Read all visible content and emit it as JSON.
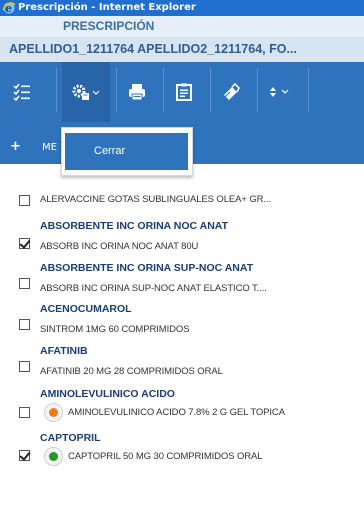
{
  "window": {
    "title": "Prescripción - Internet Explorer"
  },
  "header": {
    "section_title": "PRESCRIPCIÓN",
    "patient_name": "APELLIDO1_1211764 APELLIDO2_1211764, FO..."
  },
  "toolbar": {
    "buttons": [
      {
        "icon": "checklist-icon"
      },
      {
        "icon": "settings-menu-icon"
      },
      {
        "icon": "print-icon"
      },
      {
        "icon": "clipboard-icon"
      },
      {
        "icon": "stamp-icon"
      },
      {
        "icon": "sort-icon"
      }
    ],
    "accent": "#2f73bd"
  },
  "subbar": {
    "add_label": "ME"
  },
  "dropdown": {
    "items": [
      "Cerrar"
    ]
  },
  "medications": [
    {
      "name": "",
      "description": "ALERVACCINE GOTAS SUBLINGUALES OLEA+ GR...",
      "checked": false
    },
    {
      "name": "ABSORBENTE INC ORINA NOC ANAT",
      "description": "ABSORB INC ORINA NOC ANAT 80U",
      "checked": true
    },
    {
      "name": "ABSORBENTE INC ORINA SUP-NOC ANAT",
      "description": "ABSORB INC ORINA SUP-NOC ANAT ELASTICO T....",
      "checked": false
    },
    {
      "name": "ACENOCUMAROL",
      "description": "SINTROM 1MG 60 COMPRIMIDOS",
      "checked": false
    },
    {
      "name": "AFATINIB",
      "description": "AFATINIB 20 MG 28 COMPRIMIDOS ORAL",
      "checked": false
    },
    {
      "name": "AMINOLEVULINICO ACIDO",
      "description": "AMINOLEVULINICO ACIDO 7.8% 2 G GEL TOPICA",
      "checked": false,
      "status_color": "#f07a1a"
    },
    {
      "name": "CAPTOPRIL",
      "description": "CAPTOPRIL 50 MG 30 COMPRIMIDOS ORAL",
      "checked": true,
      "status_color": "#1f9a2a"
    }
  ]
}
